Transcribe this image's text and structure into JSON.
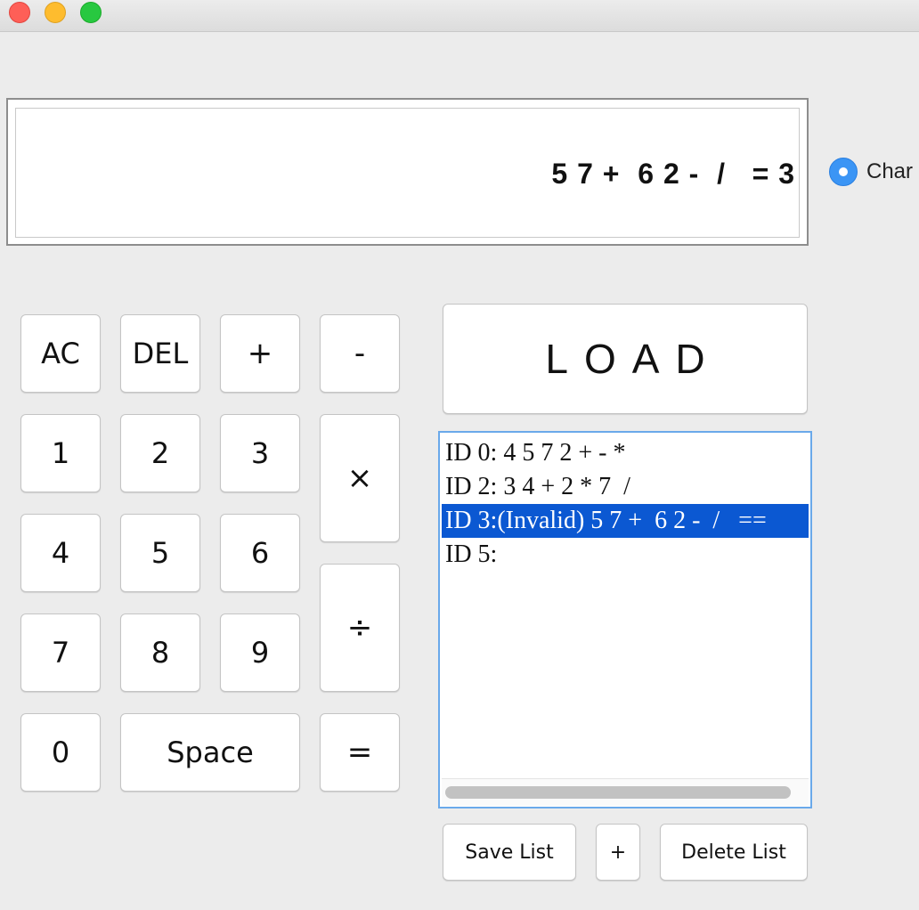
{
  "window": {
    "controls": [
      "close-button",
      "minimize-button",
      "maximize-button"
    ]
  },
  "display": {
    "expression": "5 7 +  6 2 -  /   = 3"
  },
  "mode": {
    "label": "Char",
    "selected": true
  },
  "keypad": {
    "ac": "AC",
    "del": "DEL",
    "plus": "+",
    "minus": "-",
    "one": "1",
    "two": "2",
    "three": "3",
    "multiply": "×",
    "four": "4",
    "five": "5",
    "six": "6",
    "divide": "÷",
    "seven": "7",
    "eight": "8",
    "nine": "9",
    "zero": "0",
    "space": "Space",
    "equals": "="
  },
  "load_button": "LOAD",
  "history": {
    "items": [
      "ID 0: 4 5 7 2 + - *",
      "ID 2: 3 4 + 2 * 7  /",
      "ID 3:(Invalid) 5 7 +  6 2 -  /   ==",
      "ID 5:"
    ],
    "selected_index": 2
  },
  "list_actions": {
    "save": "Save List",
    "add": "+",
    "delete": "Delete List"
  }
}
